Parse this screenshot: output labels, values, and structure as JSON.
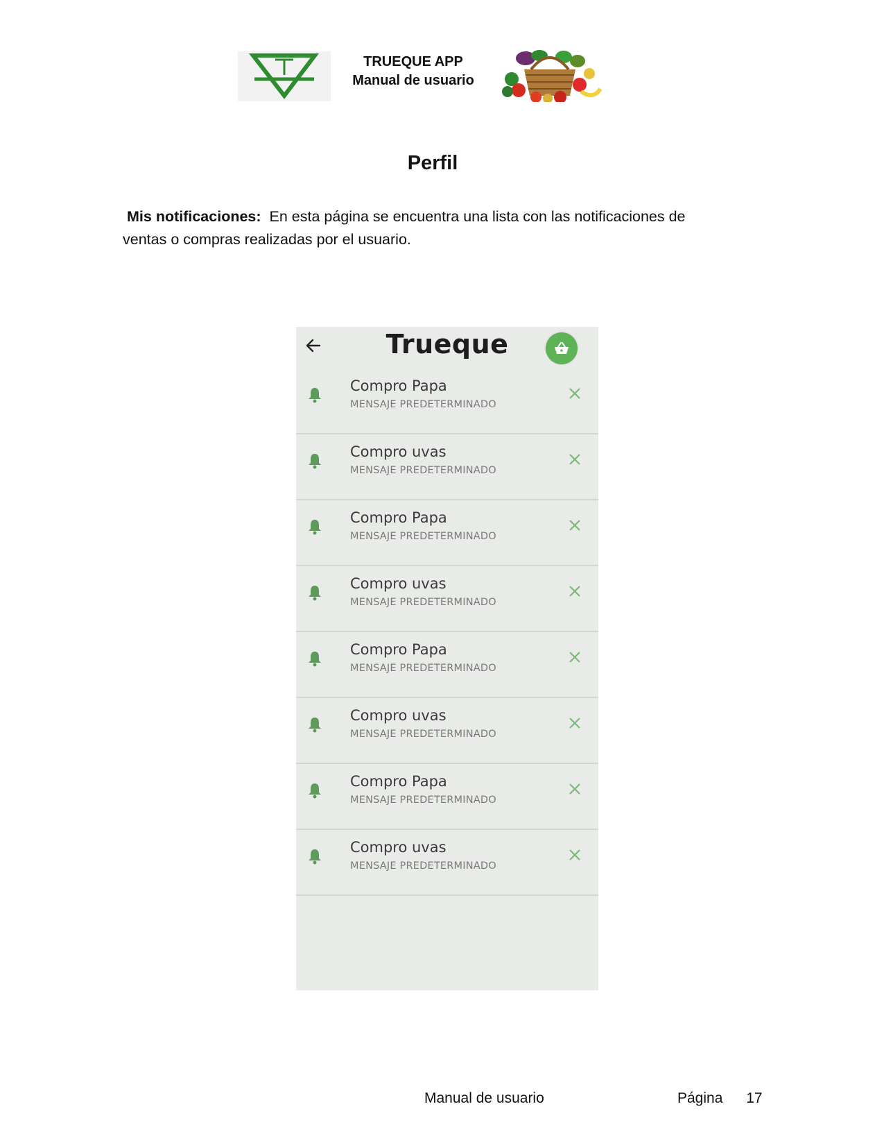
{
  "header": {
    "app_name": "TRUEQUE APP",
    "subtitle": "Manual de usuario",
    "logo_letter": "T"
  },
  "section_title": "Perfil",
  "intro": {
    "lead": "Mis notificaciones:",
    "text": "En esta página se encuentra una lista con las notificaciones de ventas o compras realizadas por el usuario."
  },
  "app": {
    "title": "Trueque",
    "accent_color": "#5fb357",
    "icons": {
      "back": "arrow-left-icon",
      "cart": "basket-icon",
      "bell": "bell-icon",
      "close": "close-icon"
    },
    "notifications": [
      {
        "title": "Compro Papa",
        "message": "MENSAJE PREDETERMINADO"
      },
      {
        "title": "Compro uvas",
        "message": "MENSAJE PREDETERMINADO"
      },
      {
        "title": "Compro Papa",
        "message": "MENSAJE PREDETERMINADO"
      },
      {
        "title": "Compro uvas",
        "message": "MENSAJE PREDETERMINADO"
      },
      {
        "title": "Compro Papa",
        "message": "MENSAJE PREDETERMINADO"
      },
      {
        "title": "Compro uvas",
        "message": "MENSAJE PREDETERMINADO"
      },
      {
        "title": "Compro Papa",
        "message": "MENSAJE PREDETERMINADO"
      },
      {
        "title": "Compro uvas",
        "message": "MENSAJE PREDETERMINADO"
      }
    ]
  },
  "footer": {
    "label": "Manual de usuario",
    "page_label": "Página",
    "page_number": "17"
  }
}
